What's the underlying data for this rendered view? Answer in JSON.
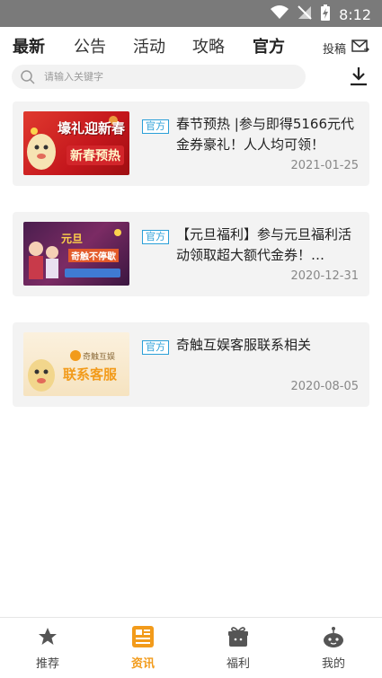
{
  "status_bar": {
    "time": "8:12"
  },
  "tabs": [
    {
      "label": "最新"
    },
    {
      "label": "公告"
    },
    {
      "label": "活动"
    },
    {
      "label": "攻略"
    },
    {
      "label": "官方"
    }
  ],
  "contribute": {
    "label": "投稿"
  },
  "search": {
    "placeholder": "请输入关键字"
  },
  "articles": [
    {
      "badge": "官方",
      "title": "春节预热 |参与即得5166元代金券豪礼！人人均可领！",
      "date": "2021-01-25",
      "thumb_text_line1": "壕礼迎新春",
      "thumb_text_line2": "新春预热"
    },
    {
      "badge": "官方",
      "title": "【元旦福利】参与元旦福利活动领取超大额代金券！…",
      "date": "2020-12-31",
      "thumb_text_line1": "元旦",
      "thumb_text_line2": "奇触不停歇"
    },
    {
      "badge": "官方",
      "title": "奇触互娱客服联系相关",
      "date": "2020-08-05",
      "thumb_text_line1": "奇触互娱",
      "thumb_text_line2": "联系客服"
    }
  ],
  "bottom_nav": [
    {
      "label": "推荐"
    },
    {
      "label": "资讯"
    },
    {
      "label": "福利"
    },
    {
      "label": "我的"
    }
  ],
  "colors": {
    "accent": "#f29b1b",
    "badge": "#2a9fd8"
  }
}
